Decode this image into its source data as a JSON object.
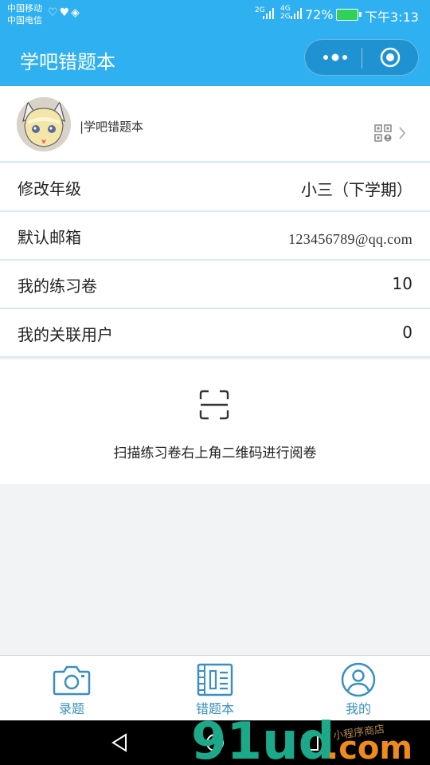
{
  "status_bar": {
    "carrier_1": "中国移动",
    "carrier_2": "中国电信",
    "signal_1": "2G",
    "signal_2": "4G",
    "signal_3": "2G",
    "battery_percent": "72%",
    "time": "下午3:13"
  },
  "nav": {
    "title": "学吧错题本",
    "more_icon": "more-dots-icon",
    "close_icon": "target-circle-icon"
  },
  "profile": {
    "name": "|学吧错题本",
    "qr_icon": "qr-code-icon",
    "chevron_icon": "chevron-right-icon"
  },
  "rows": [
    {
      "label": "修改年级",
      "value": "小三（下学期）"
    },
    {
      "label": "默认邮箱",
      "value": "123456789@qq.com"
    },
    {
      "label": "我的练习卷",
      "value": "10"
    },
    {
      "label": "我的关联用户",
      "value": "0"
    }
  ],
  "scan": {
    "icon": "scan-icon",
    "text": "扫描练习卷右上角二维码进行阅卷"
  },
  "tabs": [
    {
      "label": "录题",
      "icon": "camera-icon"
    },
    {
      "label": "错题本",
      "icon": "book-icon"
    },
    {
      "label": "我的",
      "icon": "user-icon"
    }
  ],
  "watermark": {
    "brand": "91ud",
    "suffix": ".com",
    "slogan": "小程序商店"
  },
  "colors": {
    "primary": "#2fb0f1",
    "tab_icon": "#3b8fbf",
    "divider": "#dbe9f2",
    "background": "#f2f3f5"
  }
}
